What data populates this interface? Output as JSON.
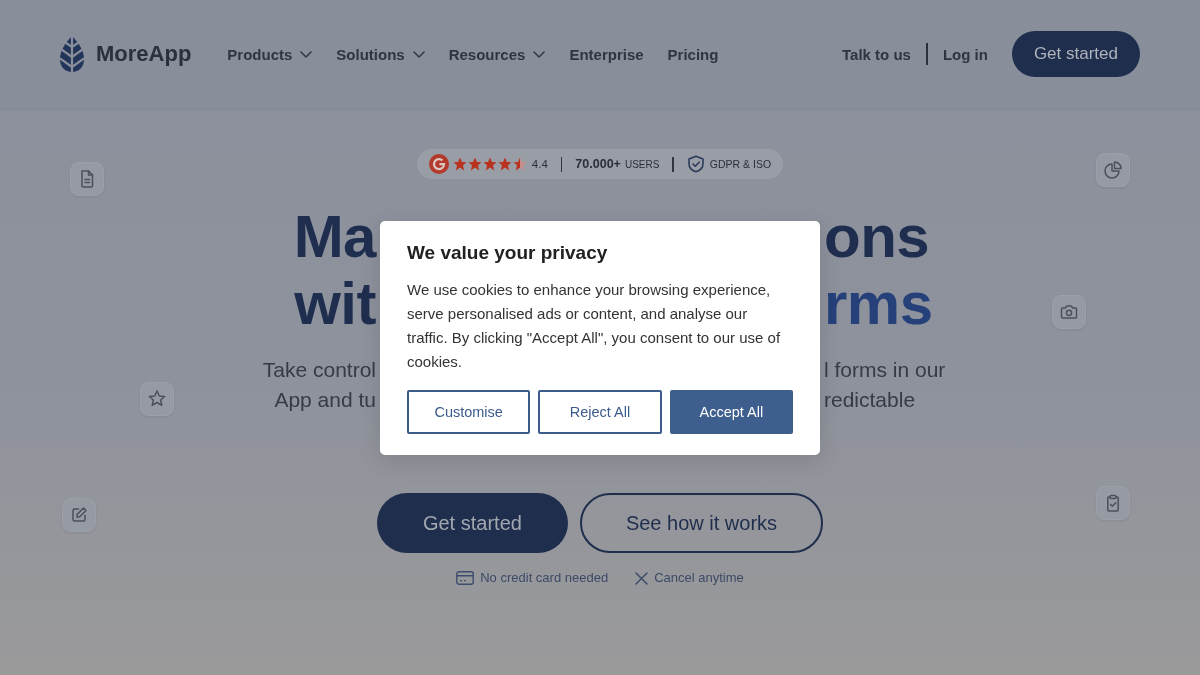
{
  "header": {
    "logo": {
      "text": "MoreApp"
    },
    "nav": [
      {
        "label": "Products",
        "kind": "dropdown"
      },
      {
        "label": "Solutions",
        "kind": "dropdown"
      },
      {
        "label": "Resources",
        "kind": "dropdown"
      },
      {
        "label": "Enterprise",
        "kind": "link"
      },
      {
        "label": "Pricing",
        "kind": "link"
      }
    ],
    "actions": [
      {
        "label": "Talk to us",
        "kind": "link"
      },
      {
        "label": "Log in",
        "kind": "link"
      },
      {
        "label": "Get started",
        "kind": "button"
      }
    ]
  },
  "hero": {
    "rating_badge": {
      "stars": 4.5,
      "score": "4.4",
      "users_count": "70.000+",
      "users_label": "USERS",
      "compliance": "GDPR & ISO"
    },
    "headline": [
      {
        "left": "Ma",
        "right": "ons",
        "right_accent": false
      },
      {
        "left": "wit",
        "right": "rms",
        "right_accent": true
      }
    ],
    "lead": [
      {
        "left": "Take control",
        "right": "l forms in our"
      },
      {
        "left": "App and tu",
        "right": "redictable"
      }
    ],
    "buttons": [
      {
        "label": "Get started",
        "kind": "primary"
      },
      {
        "label": "See how it works",
        "kind": "outline"
      }
    ],
    "notes": [
      "No credit card needed",
      "Cancel anytime"
    ]
  },
  "cookie_dialog": {
    "title": "We value your privacy",
    "body": "We use cookies to enhance your browsing experience, serve personalised ads or content, and analyse our traffic. By clicking \"Accept All\", you consent to our use of cookies.",
    "buttons": [
      {
        "label": "Customise",
        "kind": "outline"
      },
      {
        "label": "Reject All",
        "kind": "outline"
      },
      {
        "label": "Accept All",
        "kind": "primary"
      }
    ]
  }
}
